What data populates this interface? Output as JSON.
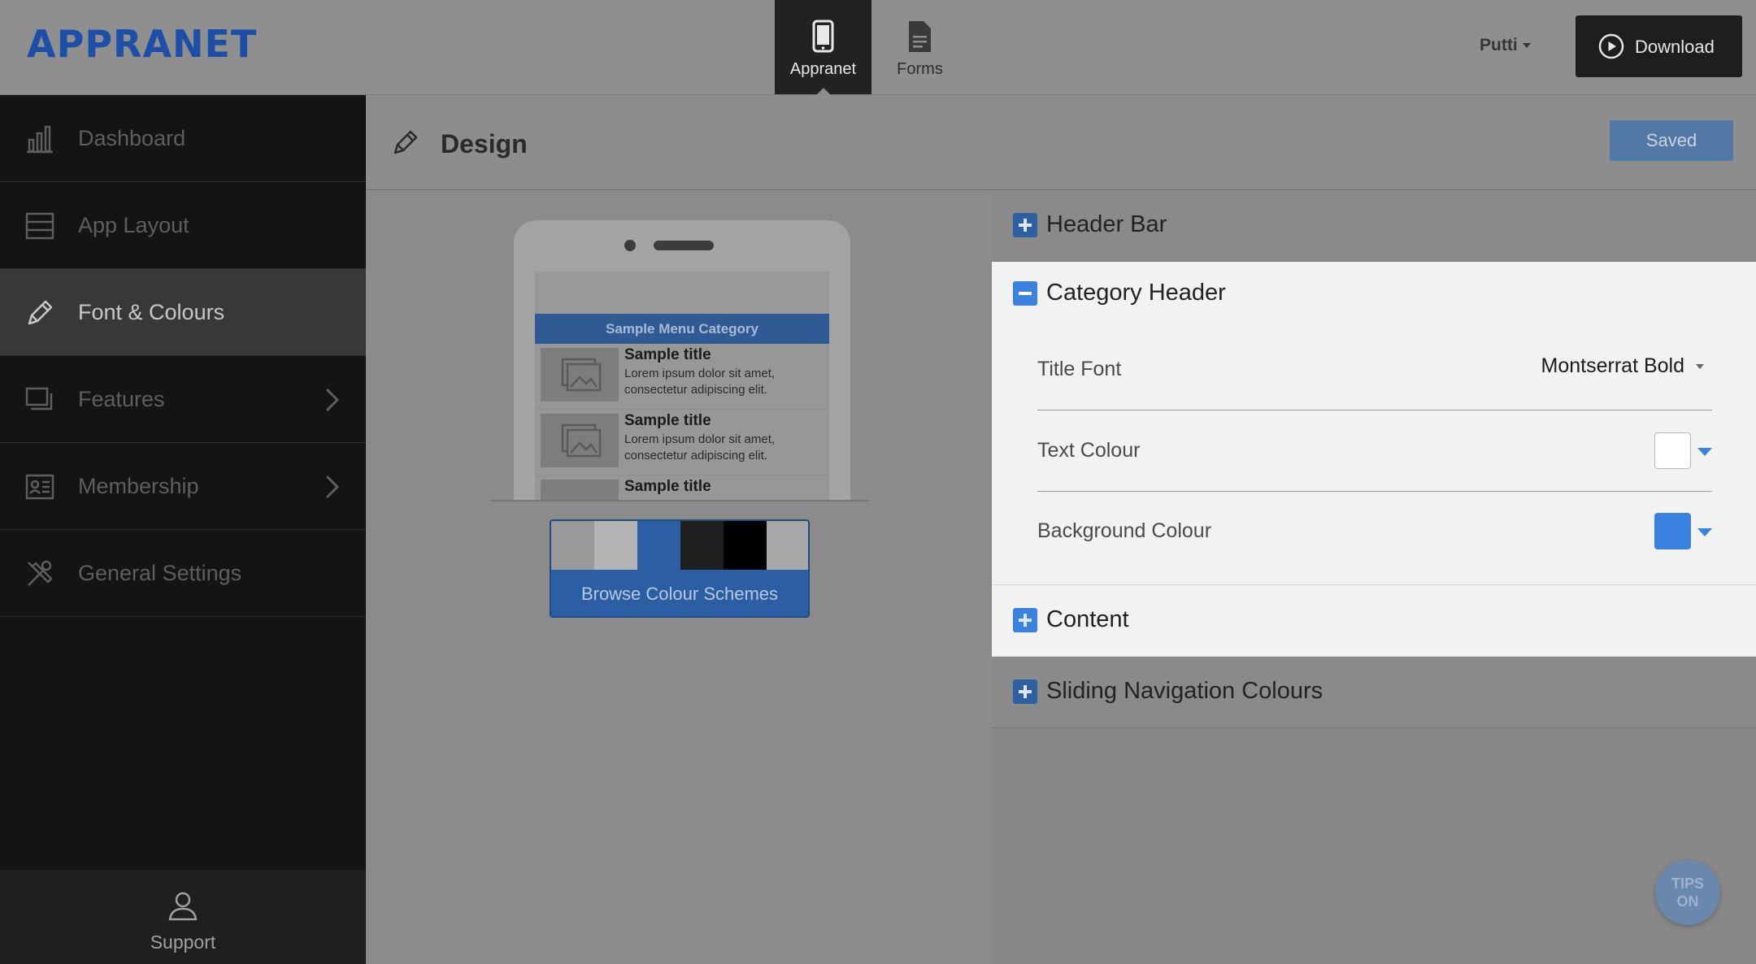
{
  "header": {
    "logo": "APPRANET",
    "tabs": [
      {
        "label": "Appranet",
        "icon": "phone-icon",
        "active": true
      },
      {
        "label": "Forms",
        "icon": "document-icon",
        "active": false
      }
    ],
    "user": "Putti",
    "download_label": "Download"
  },
  "sidebar": {
    "items": [
      {
        "label": "Dashboard",
        "icon": "bar-chart-icon"
      },
      {
        "label": "App Layout",
        "icon": "layout-icon"
      },
      {
        "label": "Font & Colours",
        "icon": "pencil-icon",
        "active": true
      },
      {
        "label": "Features",
        "icon": "stack-icon",
        "has_submenu": true
      },
      {
        "label": "Membership",
        "icon": "id-card-icon",
        "has_submenu": true
      },
      {
        "label": "General Settings",
        "icon": "tools-icon"
      }
    ],
    "support_label": "Support"
  },
  "design": {
    "title": "Design",
    "saved_label": "Saved"
  },
  "preview": {
    "category_label": "Sample Menu Category",
    "items": [
      {
        "title": "Sample title",
        "text": "Lorem ipsum dolor sit amet, consectetur adipiscing elit."
      },
      {
        "title": "Sample title",
        "text": "Lorem ipsum dolor sit amet, consectetur adipiscing elit."
      },
      {
        "title": "Sample title",
        "text": ""
      }
    ],
    "scheme_colors": [
      "#9a9a9a",
      "#b3b3b3",
      "#2c5ea3",
      "#1f1f1f",
      "#000000",
      "#a8a8a8"
    ],
    "browse_label": "Browse Colour Schemes"
  },
  "settings": {
    "sections": {
      "header_bar": "Header Bar",
      "category_header": "Category Header",
      "content": "Content",
      "sliding_nav": "Sliding Navigation Colours"
    },
    "category_header": {
      "title_font_label": "Title Font",
      "title_font_value": "Montserrat Bold",
      "text_colour_label": "Text Colour",
      "text_colour_value": "#ffffff",
      "background_colour_label": "Background Colour",
      "background_colour_value": "#3b82e0"
    }
  },
  "tips": {
    "line1": "TIPS",
    "line2": "ON"
  },
  "colors": {
    "brand": "#1d4fa8",
    "accent": "#3b82e0"
  }
}
